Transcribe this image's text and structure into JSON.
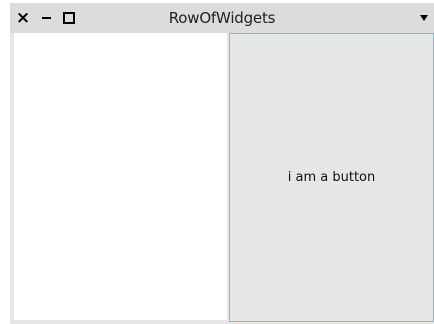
{
  "window": {
    "title": "RowOfWidgets",
    "controls": {
      "close_glyph": "×",
      "close_icon": "close-icon",
      "minimize_icon": "minimize-icon",
      "maximize_icon": "maximize-icon",
      "menu_icon": "chevron-down-icon"
    }
  },
  "row": {
    "button_label": "i am a button"
  },
  "colors": {
    "titlebar": "#dcdcdc",
    "background": "#e6e6e6",
    "panel": "#ffffff",
    "button_border": "#8eb3df"
  }
}
